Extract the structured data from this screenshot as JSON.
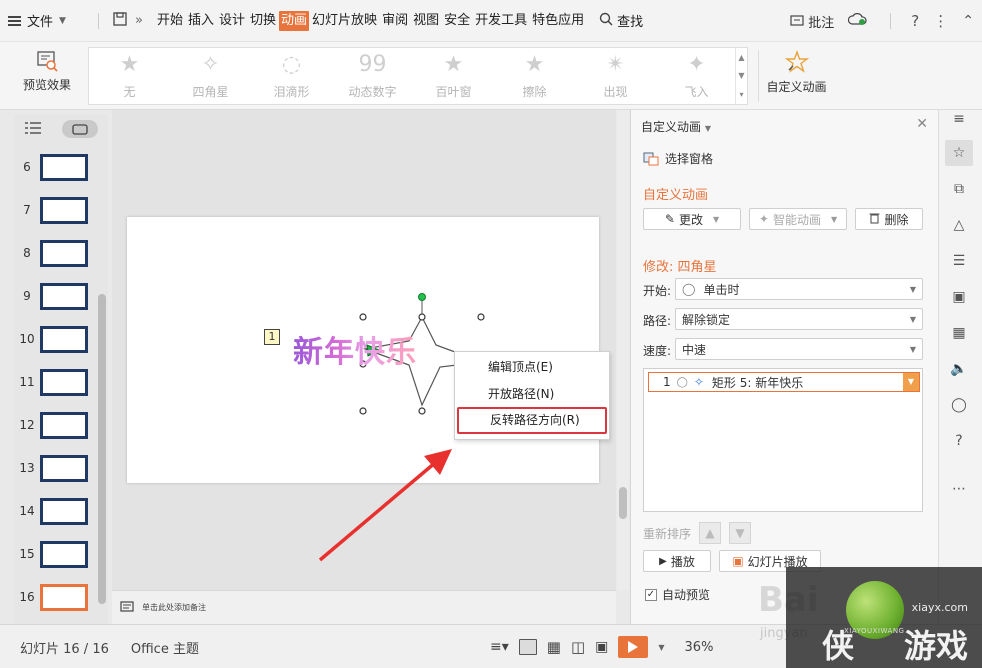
{
  "menubar": {
    "file": "文件",
    "tabs": [
      {
        "label": "开始",
        "active": false
      },
      {
        "label": "插入",
        "active": false
      },
      {
        "label": "设计",
        "active": false
      },
      {
        "label": "切换",
        "active": false
      },
      {
        "label": "动画",
        "active": true
      },
      {
        "label": "幻灯片放映",
        "active": false
      },
      {
        "label": "审阅",
        "active": false
      },
      {
        "label": "视图",
        "active": false
      },
      {
        "label": "安全",
        "active": false
      },
      {
        "label": "开发工具",
        "active": false
      },
      {
        "label": "特色应用",
        "active": false
      }
    ],
    "search": "查找",
    "comment": "批注",
    "help": "?",
    "accent_color": "#e8743b"
  },
  "ribbon": {
    "preview": "预览效果",
    "gallery": [
      {
        "label": "无",
        "icon": "star-icon"
      },
      {
        "label": "四角星",
        "icon": "four-point-star-icon"
      },
      {
        "label": "泪滴形",
        "icon": "teardrop-icon"
      },
      {
        "label": "动态数字",
        "icon": "digits-icon"
      },
      {
        "label": "百叶窗",
        "icon": "blinds-star-icon"
      },
      {
        "label": "擦除",
        "icon": "wipe-star-icon"
      },
      {
        "label": "出现",
        "icon": "appear-star-icon"
      },
      {
        "label": "飞入",
        "icon": "fly-in-star-icon"
      }
    ],
    "custom_animation": "自定义动画"
  },
  "thumbnails": {
    "slides": [
      {
        "num": "6",
        "selected": false
      },
      {
        "num": "7",
        "selected": false
      },
      {
        "num": "8",
        "selected": false
      },
      {
        "num": "9",
        "selected": false
      },
      {
        "num": "10",
        "selected": false
      },
      {
        "num": "11",
        "selected": false
      },
      {
        "num": "12",
        "selected": false
      },
      {
        "num": "13",
        "selected": false
      },
      {
        "num": "14",
        "selected": false
      },
      {
        "num": "15",
        "selected": false
      },
      {
        "num": "16",
        "selected": true
      }
    ]
  },
  "slide": {
    "badge": "1",
    "wordart": "新年快乐"
  },
  "notes": {
    "placeholder": "单击此处添加备注"
  },
  "context_menu": {
    "items": [
      "编辑顶点(E)",
      "开放路径(N)",
      "反转路径方向(R)"
    ]
  },
  "pane": {
    "title": "自定义动画",
    "selection_pane": "选择窗格",
    "section": "自定义动画",
    "buttons": {
      "change": "更改",
      "smart": "智能动画",
      "delete": "删除"
    },
    "modify": "修改: 四角星",
    "start_label": "开始:",
    "start_value": "单击时",
    "path_label": "路径:",
    "path_value": "解除锁定",
    "speed_label": "速度:",
    "speed_value": "中速",
    "list_item": {
      "index": "1",
      "text": "矩形 5: 新年快乐"
    },
    "reorder": "重新排序",
    "play": "播放",
    "slideshow": "幻灯片播放",
    "auto_preview": "自动预览"
  },
  "statusbar": {
    "slide_info": "幻灯片 16 / 16",
    "theme": "Office 主题",
    "zoom": "36%"
  },
  "watermarks": {
    "baidu": "Bai",
    "jingyan": "jingyan",
    "site_url": "xiayx.com",
    "site_name_a": "侠",
    "site_name_b": "游戏",
    "site_pinyin": "XIAYOUXIWANG"
  }
}
